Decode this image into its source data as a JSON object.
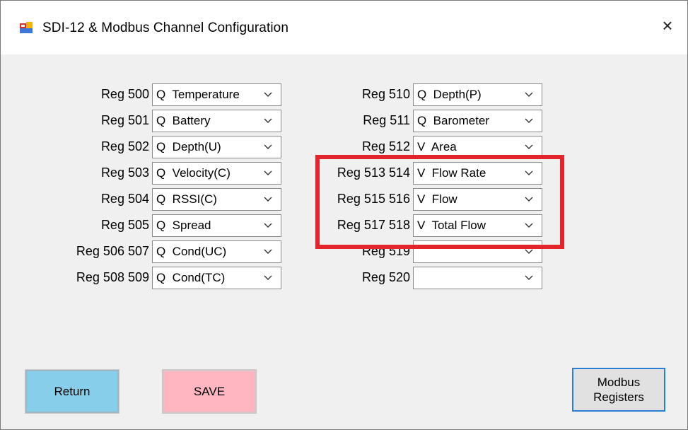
{
  "window": {
    "title": "SDI-12 & Modbus Channel Configuration",
    "close_glyph": "×"
  },
  "left_column": [
    {
      "label": "Reg 500",
      "value": "Q  Temperature"
    },
    {
      "label": "Reg 501",
      "value": "Q  Battery"
    },
    {
      "label": "Reg 502",
      "value": "Q  Depth(U)"
    },
    {
      "label": "Reg 503",
      "value": "Q  Velocity(C)"
    },
    {
      "label": "Reg 504",
      "value": "Q  RSSI(C)"
    },
    {
      "label": "Reg 505",
      "value": "Q  Spread"
    },
    {
      "label": "Reg 506 507",
      "value": "Q  Cond(UC)"
    },
    {
      "label": "Reg 508 509",
      "value": "Q  Cond(TC)"
    }
  ],
  "right_column": [
    {
      "label": "Reg 510",
      "value": "Q  Depth(P)"
    },
    {
      "label": "Reg 511",
      "value": "Q  Barometer"
    },
    {
      "label": "Reg 512",
      "value": "V  Area"
    },
    {
      "label": "Reg 513 514",
      "value": "V  Flow Rate"
    },
    {
      "label": "Reg 515 516",
      "value": "V  Flow"
    },
    {
      "label": "Reg 517 518",
      "value": "V  Total Flow"
    },
    {
      "label": "Reg 519",
      "value": ""
    },
    {
      "label": "Reg 520",
      "value": ""
    }
  ],
  "buttons": {
    "return_label": "Return",
    "save_label": "SAVE",
    "modbus_label_line1": "Modbus",
    "modbus_label_line2": "Registers"
  },
  "icons": {
    "app": "app-window-icon",
    "dropdown": "chevron-down-icon",
    "close": "close-icon"
  },
  "colors": {
    "return_button": "#87ceeb",
    "save_button": "#ffb6c1",
    "highlight_box": "#e3242b",
    "modbus_border": "#2a7fd4"
  }
}
